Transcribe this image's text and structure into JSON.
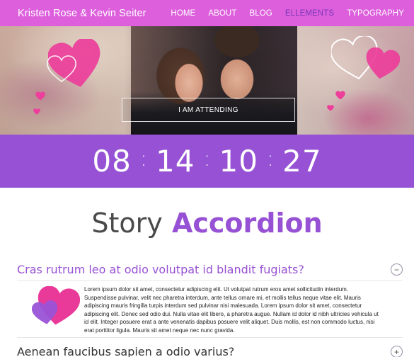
{
  "header": {
    "brand": "Kristen Rose & Kevin Seiter",
    "nav": [
      "HOME",
      "ABOUT",
      "BLOG",
      "ELLEMENTS",
      "TYPOGRAPHY"
    ],
    "active_nav": "ELLEMENTS",
    "colors": {
      "bar": "#dd5fdc",
      "active": "#7a35b8"
    }
  },
  "hero": {
    "button_label": "I AM ATTENDING",
    "heart_color": "#e8349c"
  },
  "countdown": {
    "values": [
      "08",
      "14",
      "10",
      "27"
    ],
    "separator": ":",
    "background": "#9751d4"
  },
  "section": {
    "title_light": "Story",
    "title_bold": "Accordion"
  },
  "accordion": {
    "items": [
      {
        "title": "Cras rutrum leo at odio volutpat id blandit fugiats?",
        "toggle": "−"
      },
      {
        "title": "Aenean faucibus sapien a odio varius?",
        "toggle": "+"
      }
    ],
    "body_text": "Lorem ipsum dolor sit amet, consectetur adipiscing elit. Ut volutpat rutrum eros amet sollicitudin interdum. Suspendisse pulvinar, velit nec pharetra interdum, ante tellus ornare mi, et mollis tellus neque vitae elit. Mauris adipiscing mauris fringilla turpis interdum sed pulvinar nisi malesuada. Lorem ipsum dolor sit amet, consectetur adipiscing elit. Donec sed odio dui. Nulla vitae elit libero, a pharetra augue. Nullam id dolor id nibh ultricies vehicula ut id elit. Integer posuere erat a ante venenatis dapibus posuere velit aliquet. Duis mollis, est non commodo luctus, nisi erat porttitor ligula. Mauris sit amet neque nec nunc gravida."
  }
}
